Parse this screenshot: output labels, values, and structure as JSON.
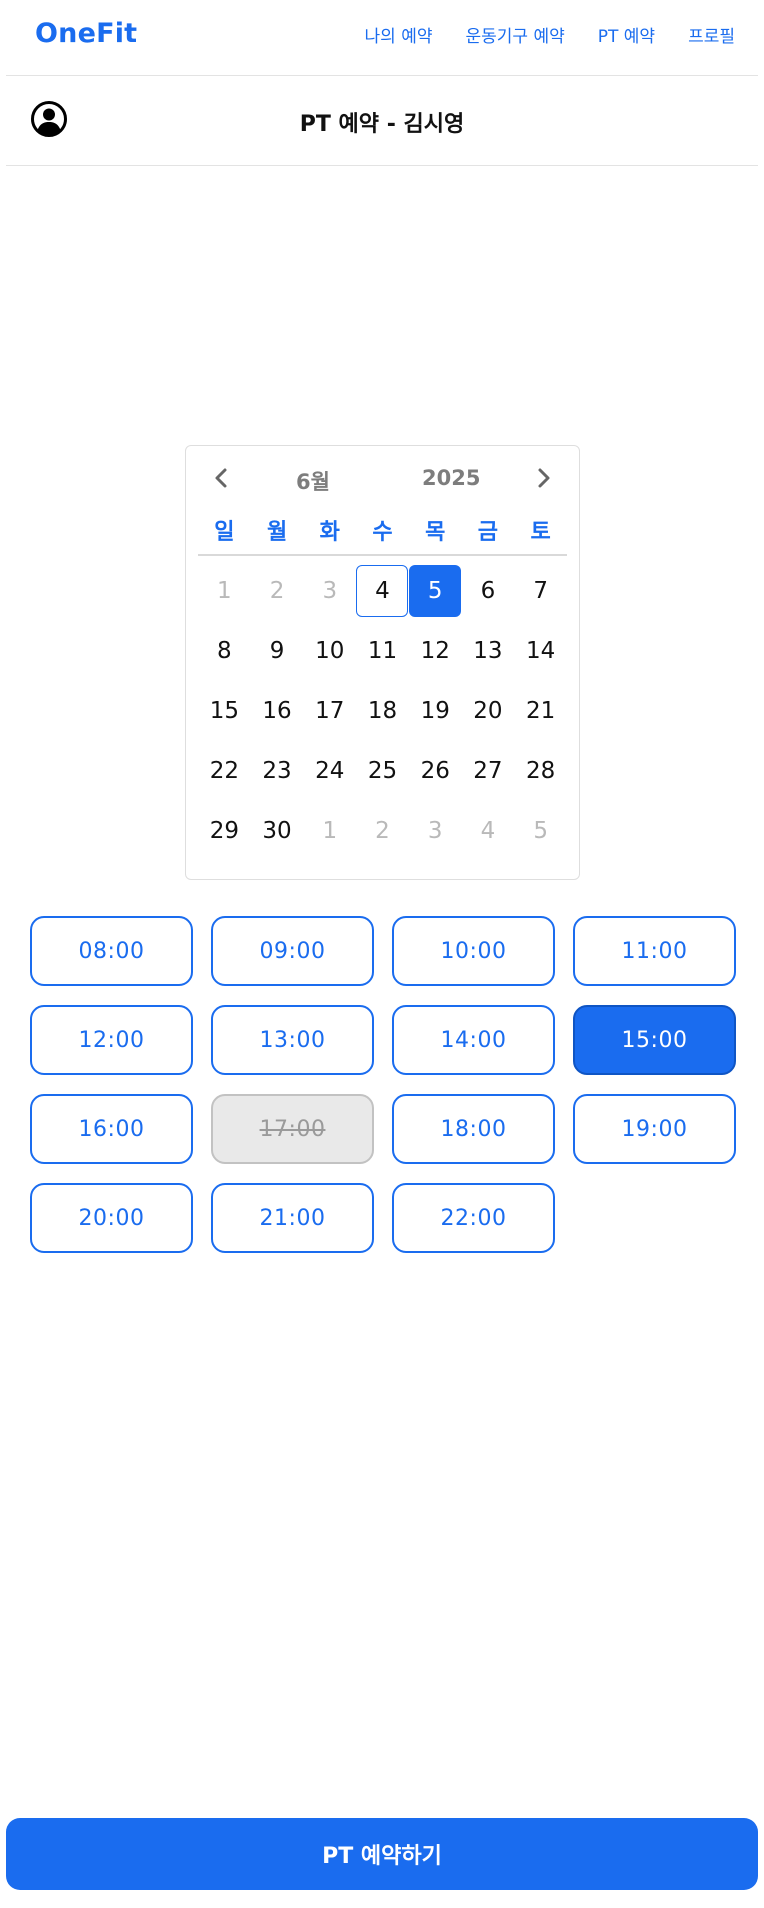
{
  "app": {
    "logo": "OneFit"
  },
  "nav": {
    "items": [
      "나의 예약",
      "운동기구 예약",
      "PT 예약",
      "프로필"
    ]
  },
  "header": {
    "title": "PT 예약 - 김시영",
    "profile_icon": "user-circle-icon"
  },
  "calendar": {
    "month": "6월",
    "year": "2025",
    "prev_icon": "chevron-left-icon",
    "next_icon": "chevron-right-icon",
    "weekdays": [
      "일",
      "월",
      "화",
      "수",
      "목",
      "금",
      "토"
    ],
    "days": [
      {
        "label": "1",
        "muted": true
      },
      {
        "label": "2",
        "muted": true
      },
      {
        "label": "3",
        "muted": true
      },
      {
        "label": "4",
        "today": true
      },
      {
        "label": "5",
        "selected": true
      },
      {
        "label": "6"
      },
      {
        "label": "7"
      },
      {
        "label": "8"
      },
      {
        "label": "9"
      },
      {
        "label": "10"
      },
      {
        "label": "11"
      },
      {
        "label": "12"
      },
      {
        "label": "13"
      },
      {
        "label": "14"
      },
      {
        "label": "15"
      },
      {
        "label": "16"
      },
      {
        "label": "17"
      },
      {
        "label": "18"
      },
      {
        "label": "19"
      },
      {
        "label": "20"
      },
      {
        "label": "21"
      },
      {
        "label": "22"
      },
      {
        "label": "23"
      },
      {
        "label": "24"
      },
      {
        "label": "25"
      },
      {
        "label": "26"
      },
      {
        "label": "27"
      },
      {
        "label": "28"
      },
      {
        "label": "29"
      },
      {
        "label": "30"
      },
      {
        "label": "1",
        "muted": true
      },
      {
        "label": "2",
        "muted": true
      },
      {
        "label": "3",
        "muted": true
      },
      {
        "label": "4",
        "muted": true
      },
      {
        "label": "5",
        "muted": true
      }
    ]
  },
  "time_slots": [
    {
      "label": "08:00"
    },
    {
      "label": "09:00"
    },
    {
      "label": "10:00"
    },
    {
      "label": "11:00"
    },
    {
      "label": "12:00"
    },
    {
      "label": "13:00"
    },
    {
      "label": "14:00"
    },
    {
      "label": "15:00",
      "selected": true
    },
    {
      "label": "16:00"
    },
    {
      "label": "17:00",
      "disabled": true
    },
    {
      "label": "18:00"
    },
    {
      "label": "19:00"
    },
    {
      "label": "20:00"
    },
    {
      "label": "21:00"
    },
    {
      "label": "22:00"
    }
  ],
  "actions": {
    "book_label": "PT 예약하기"
  },
  "colors": {
    "accent": "#1a6cef",
    "muted_text": "#b9b9b9",
    "disabled_bg": "#e9e9e9"
  }
}
